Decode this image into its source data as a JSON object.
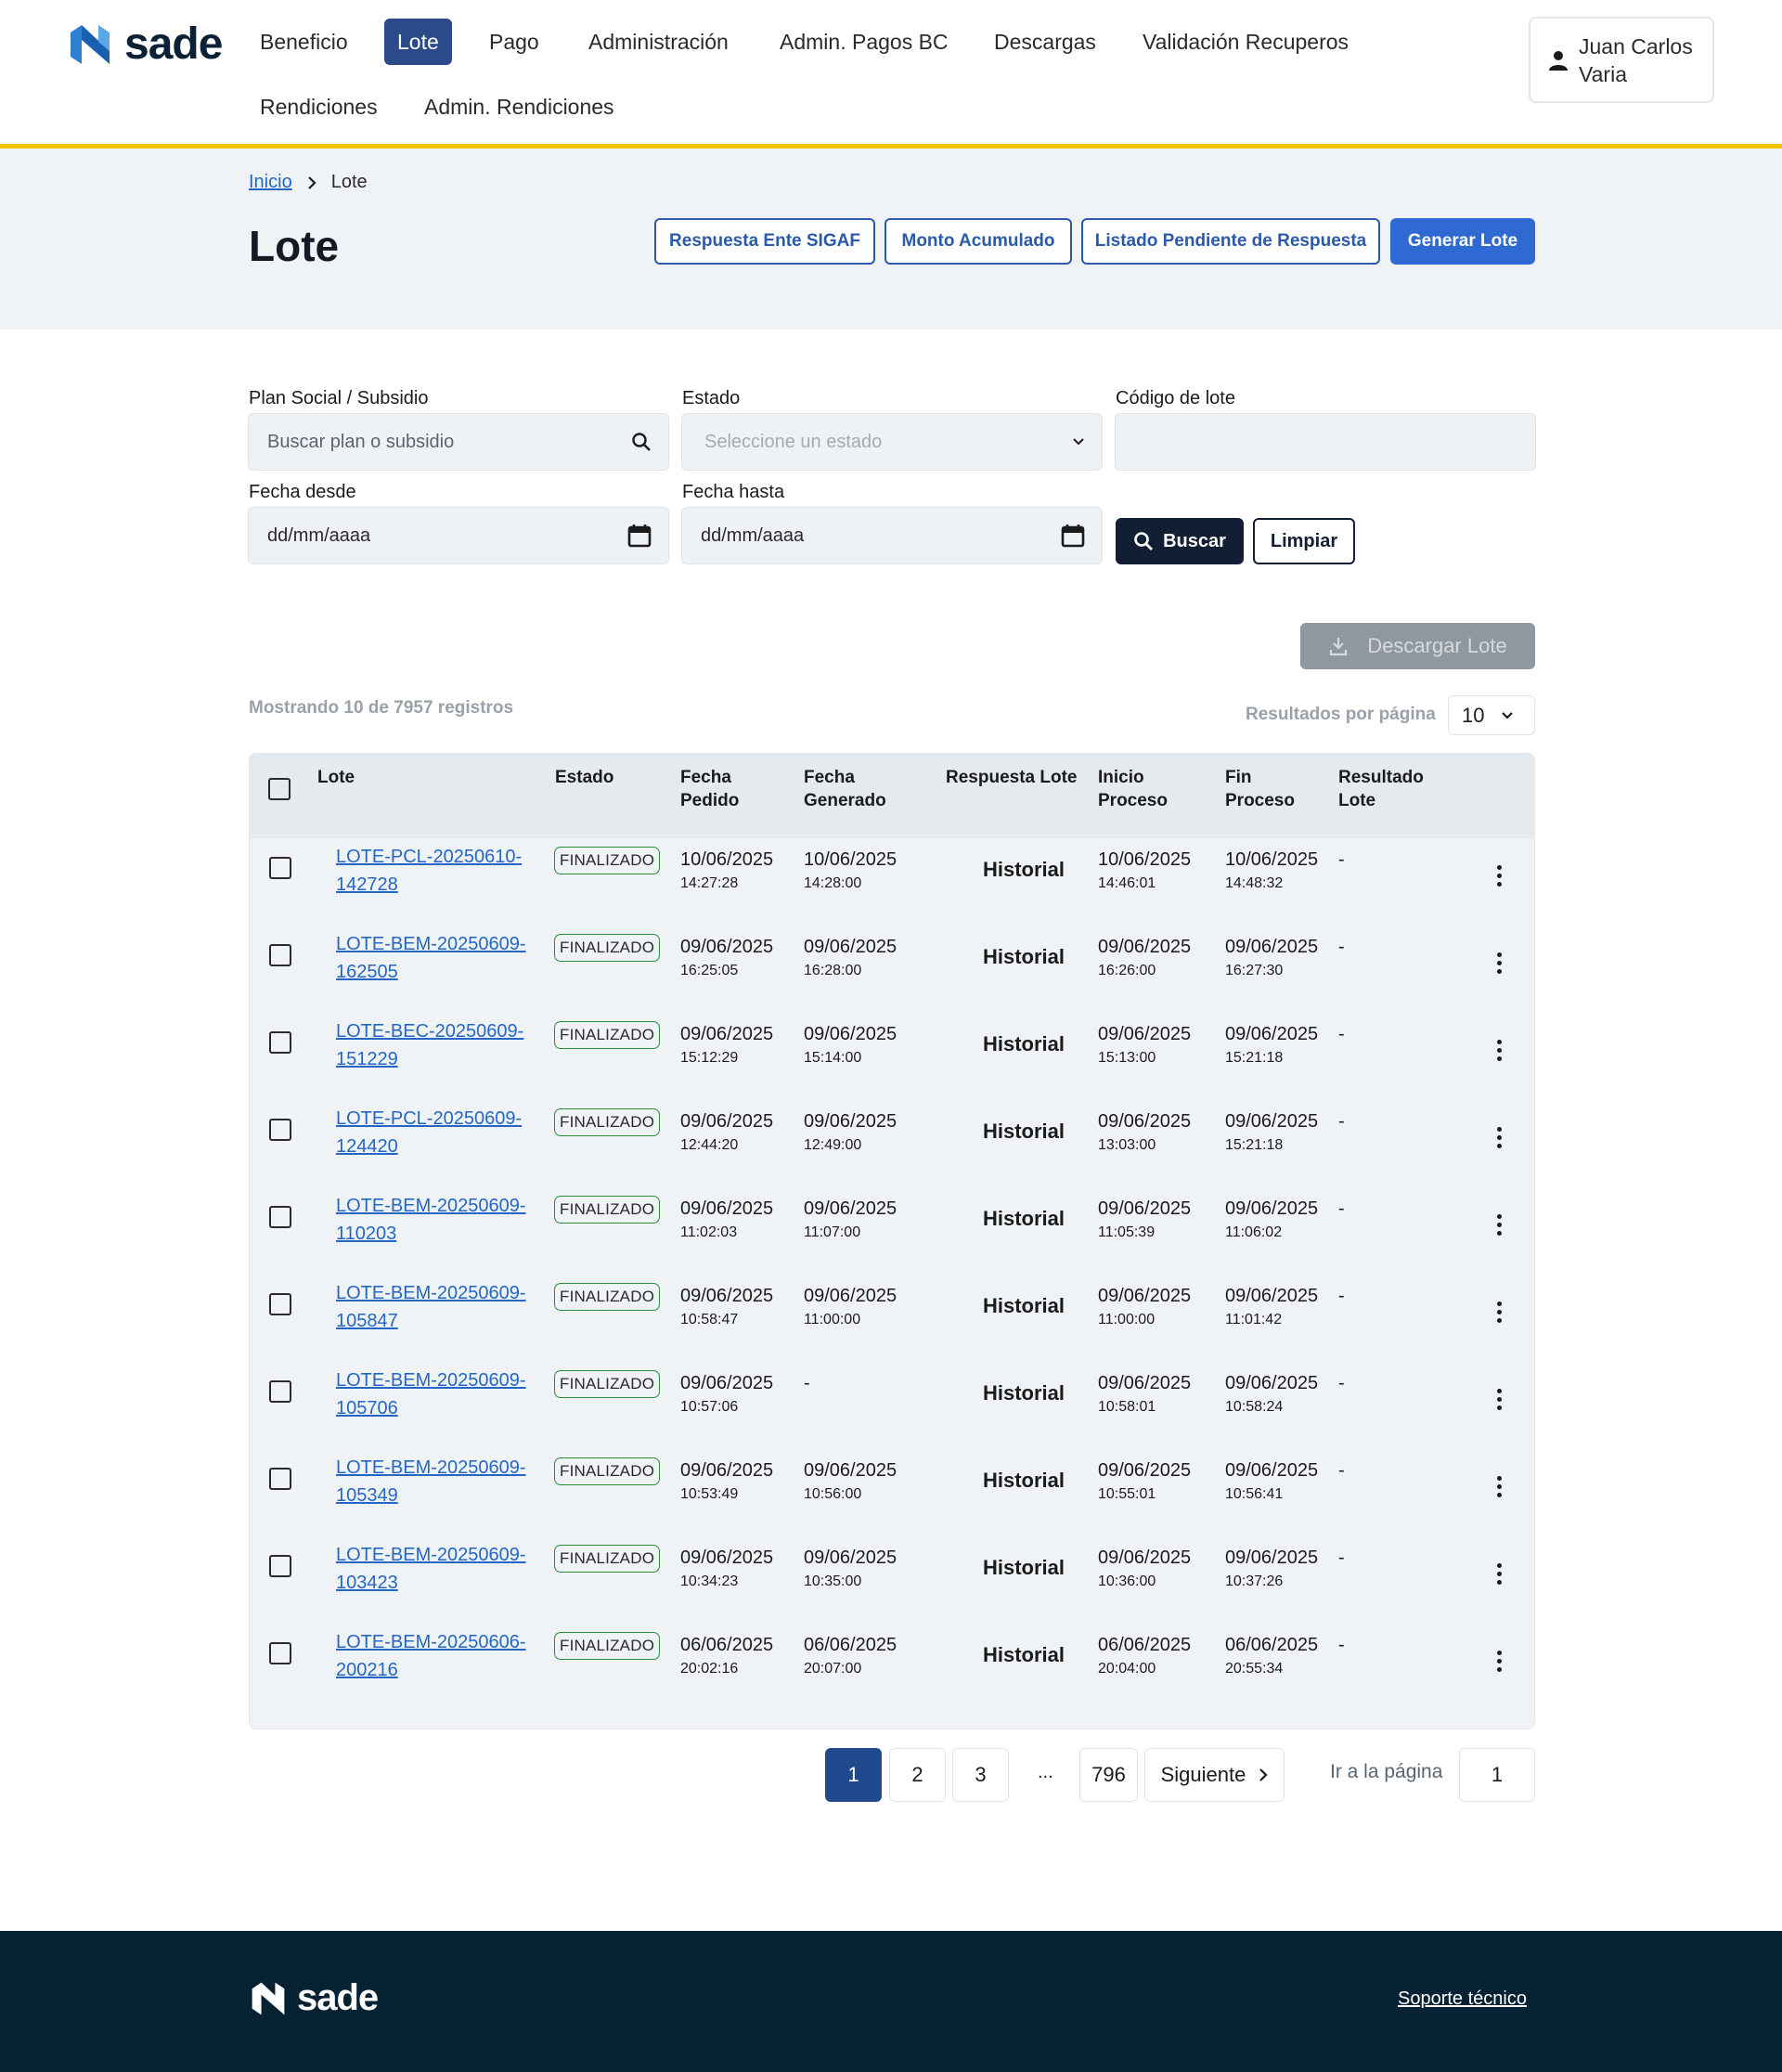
{
  "brand": {
    "name": "sade",
    "colors": {
      "accent": "#f2c500",
      "primary": "#2e6ad2",
      "nav_active": "#2a4a8a",
      "dark": "#121e33",
      "footer": "#062233",
      "badge_border": "#2e8b3e",
      "link": "#2467c6"
    }
  },
  "nav": {
    "items": [
      "Beneficio",
      "Lote",
      "Pago",
      "Administración",
      "Admin. Pagos BC",
      "Descargas",
      "Validación Recuperos",
      "Rendiciones",
      "Admin. Rendiciones"
    ],
    "active": "Lote"
  },
  "user": {
    "name": "Juan Carlos Varia",
    "icon": "user-icon"
  },
  "breadcrumb": {
    "home": "Inicio",
    "current": "Lote"
  },
  "page": {
    "title": "Lote"
  },
  "actions": {
    "respuesta_sigaf": "Respuesta Ente SIGAF",
    "monto_acumulado": "Monto Acumulado",
    "listado_pendiente": "Listado Pendiente de Respuesta",
    "generar_lote": "Generar Lote"
  },
  "filters": {
    "plan_label": "Plan Social / Subsidio",
    "plan_placeholder": "Buscar plan o subsidio",
    "estado_label": "Estado",
    "estado_placeholder": "Seleccione un estado",
    "codigo_label": "Código de lote",
    "codigo_value": "",
    "fecha_desde_label": "Fecha desde",
    "fecha_desde_placeholder": "dd/mm/aaaa",
    "fecha_hasta_label": "Fecha hasta",
    "fecha_hasta_placeholder": "dd/mm/aaaa",
    "buscar": "Buscar",
    "limpiar": "Limpiar"
  },
  "download": {
    "label": "Descargar Lote"
  },
  "results": {
    "showing": "Mostrando 10 de 7957 registros",
    "per_page_label": "Resultados por página",
    "per_page_value": "10"
  },
  "table": {
    "headers": {
      "lote": "Lote",
      "estado": "Estado",
      "fecha_pedido": "Fecha Pedido",
      "fecha_generado": "Fecha Generado",
      "respuesta_lote": "Respuesta Lote",
      "inicio_proceso": "Inicio Proceso",
      "fin_proceso": "Fin Proceso",
      "resultado_lote": "Resultado Lote"
    },
    "rows": [
      {
        "lote": "LOTE-PCL-20250610-142728",
        "estado": "FINALIZADO",
        "pedido_fecha": "10/06/2025",
        "pedido_hora": "14:27:28",
        "generado_fecha": "10/06/2025",
        "generado_hora": "14:28:00",
        "respuesta": "Historial",
        "inicio_fecha": "10/06/2025",
        "inicio_hora": "14:46:01",
        "fin_fecha": "10/06/2025",
        "fin_hora": "14:48:32",
        "resultado": "-"
      },
      {
        "lote": "LOTE-BEM-20250609-162505",
        "estado": "FINALIZADO",
        "pedido_fecha": "09/06/2025",
        "pedido_hora": "16:25:05",
        "generado_fecha": "09/06/2025",
        "generado_hora": "16:28:00",
        "respuesta": "Historial",
        "inicio_fecha": "09/06/2025",
        "inicio_hora": "16:26:00",
        "fin_fecha": "09/06/2025",
        "fin_hora": "16:27:30",
        "resultado": "-"
      },
      {
        "lote": "LOTE-BEC-20250609-151229",
        "estado": "FINALIZADO",
        "pedido_fecha": "09/06/2025",
        "pedido_hora": "15:12:29",
        "generado_fecha": "09/06/2025",
        "generado_hora": "15:14:00",
        "respuesta": "Historial",
        "inicio_fecha": "09/06/2025",
        "inicio_hora": "15:13:00",
        "fin_fecha": "09/06/2025",
        "fin_hora": "15:21:18",
        "resultado": "-"
      },
      {
        "lote": "LOTE-PCL-20250609-124420",
        "estado": "FINALIZADO",
        "pedido_fecha": "09/06/2025",
        "pedido_hora": "12:44:20",
        "generado_fecha": "09/06/2025",
        "generado_hora": "12:49:00",
        "respuesta": "Historial",
        "inicio_fecha": "09/06/2025",
        "inicio_hora": "13:03:00",
        "fin_fecha": "09/06/2025",
        "fin_hora": "15:21:18",
        "resultado": "-"
      },
      {
        "lote": "LOTE-BEM-20250609-110203",
        "estado": "FINALIZADO",
        "pedido_fecha": "09/06/2025",
        "pedido_hora": "11:02:03",
        "generado_fecha": "09/06/2025",
        "generado_hora": "11:07:00",
        "respuesta": "Historial",
        "inicio_fecha": "09/06/2025",
        "inicio_hora": "11:05:39",
        "fin_fecha": "09/06/2025",
        "fin_hora": "11:06:02",
        "resultado": "-"
      },
      {
        "lote": "LOTE-BEM-20250609-105847",
        "estado": "FINALIZADO",
        "pedido_fecha": "09/06/2025",
        "pedido_hora": "10:58:47",
        "generado_fecha": "09/06/2025",
        "generado_hora": "11:00:00",
        "respuesta": "Historial",
        "inicio_fecha": "09/06/2025",
        "inicio_hora": "11:00:00",
        "fin_fecha": "09/06/2025",
        "fin_hora": "11:01:42",
        "resultado": "-"
      },
      {
        "lote": "LOTE-BEM-20250609-105706",
        "estado": "FINALIZADO",
        "pedido_fecha": "09/06/2025",
        "pedido_hora": "10:57:06",
        "generado_fecha": "-",
        "generado_hora": "",
        "respuesta": "Historial",
        "inicio_fecha": "09/06/2025",
        "inicio_hora": "10:58:01",
        "fin_fecha": "09/06/2025",
        "fin_hora": "10:58:24",
        "resultado": "-"
      },
      {
        "lote": "LOTE-BEM-20250609-105349",
        "estado": "FINALIZADO",
        "pedido_fecha": "09/06/2025",
        "pedido_hora": "10:53:49",
        "generado_fecha": "09/06/2025",
        "generado_hora": "10:56:00",
        "respuesta": "Historial",
        "inicio_fecha": "09/06/2025",
        "inicio_hora": "10:55:01",
        "fin_fecha": "09/06/2025",
        "fin_hora": "10:56:41",
        "resultado": "-"
      },
      {
        "lote": "LOTE-BEM-20250609-103423",
        "estado": "FINALIZADO",
        "pedido_fecha": "09/06/2025",
        "pedido_hora": "10:34:23",
        "generado_fecha": "09/06/2025",
        "generado_hora": "10:35:00",
        "respuesta": "Historial",
        "inicio_fecha": "09/06/2025",
        "inicio_hora": "10:36:00",
        "fin_fecha": "09/06/2025",
        "fin_hora": "10:37:26",
        "resultado": "-"
      },
      {
        "lote": "LOTE-BEM-20250606-200216",
        "estado": "FINALIZADO",
        "pedido_fecha": "06/06/2025",
        "pedido_hora": "20:02:16",
        "generado_fecha": "06/06/2025",
        "generado_hora": "20:07:00",
        "respuesta": "Historial",
        "inicio_fecha": "06/06/2025",
        "inicio_hora": "20:04:00",
        "fin_fecha": "06/06/2025",
        "fin_hora": "20:55:34",
        "resultado": "-"
      }
    ]
  },
  "pagination": {
    "pages": [
      "1",
      "2",
      "3"
    ],
    "ellipsis": "...",
    "last": "796",
    "next": "Siguiente",
    "goto_label": "Ir a la página",
    "goto_value": "1",
    "current": "1"
  },
  "footer": {
    "brand": "sade",
    "support": "Soporte técnico"
  }
}
